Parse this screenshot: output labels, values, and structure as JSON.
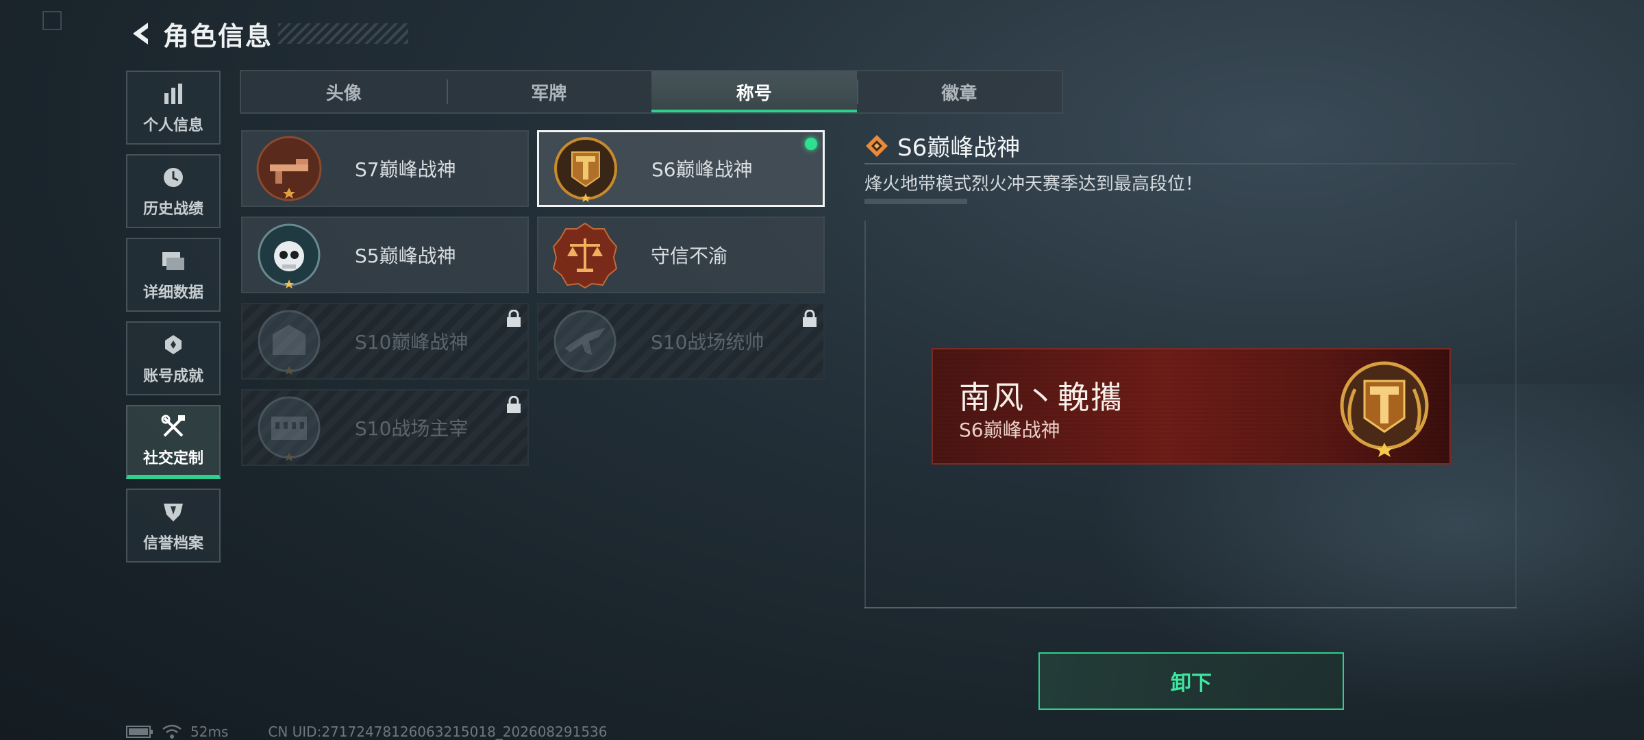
{
  "header": {
    "title": "角色信息"
  },
  "sidebar": {
    "items": [
      {
        "label": "个人信息",
        "icon": "bar-chart-icon"
      },
      {
        "label": "历史战绩",
        "icon": "clock-icon"
      },
      {
        "label": "详细数据",
        "icon": "folder-icon"
      },
      {
        "label": "账号成就",
        "icon": "achievement-icon"
      },
      {
        "label": "社交定制",
        "icon": "tools-icon",
        "active": true
      },
      {
        "label": "信誉档案",
        "icon": "shield-icon"
      }
    ]
  },
  "tabs": [
    {
      "label": "头像"
    },
    {
      "label": "军牌"
    },
    {
      "label": "称号",
      "active": true
    },
    {
      "label": "徽章"
    }
  ],
  "titles": [
    {
      "name": "S7巅峰战神",
      "locked": false,
      "selected": false,
      "emblem": "rifle-emblem-icon"
    },
    {
      "name": "S6巅峰战神",
      "locked": false,
      "selected": true,
      "equipped": true,
      "emblem": "gold-t-emblem-icon"
    },
    {
      "name": "S5巅峰战神",
      "locked": false,
      "selected": false,
      "emblem": "skull-emblem-icon"
    },
    {
      "name": "守信不渝",
      "locked": false,
      "selected": false,
      "emblem": "scales-emblem-icon"
    },
    {
      "name": "S10巅峰战神",
      "locked": true,
      "selected": false,
      "emblem": "building-emblem-icon"
    },
    {
      "name": "S10战场统帅",
      "locked": true,
      "selected": false,
      "emblem": "aircraft-emblem-icon"
    },
    {
      "name": "S10战场主宰",
      "locked": true,
      "selected": false,
      "emblem": "colosseum-emblem-icon"
    }
  ],
  "detail": {
    "title": "S6巅峰战神",
    "description": "烽火地带模式烈火冲天赛季达到最高段位！"
  },
  "nameplate": {
    "player_name": "南风丶輓攜",
    "title": "S6巅峰战神"
  },
  "actions": {
    "unequip_label": "卸下"
  },
  "status": {
    "ping": "52ms",
    "uid": "CN UID:27172478126063215018_202608291536"
  },
  "colors": {
    "accent": "#2fd08f",
    "equipped_dot": "#2fe08f",
    "nameplate_red": "#6e1d18",
    "gold": "#c98a2c"
  }
}
